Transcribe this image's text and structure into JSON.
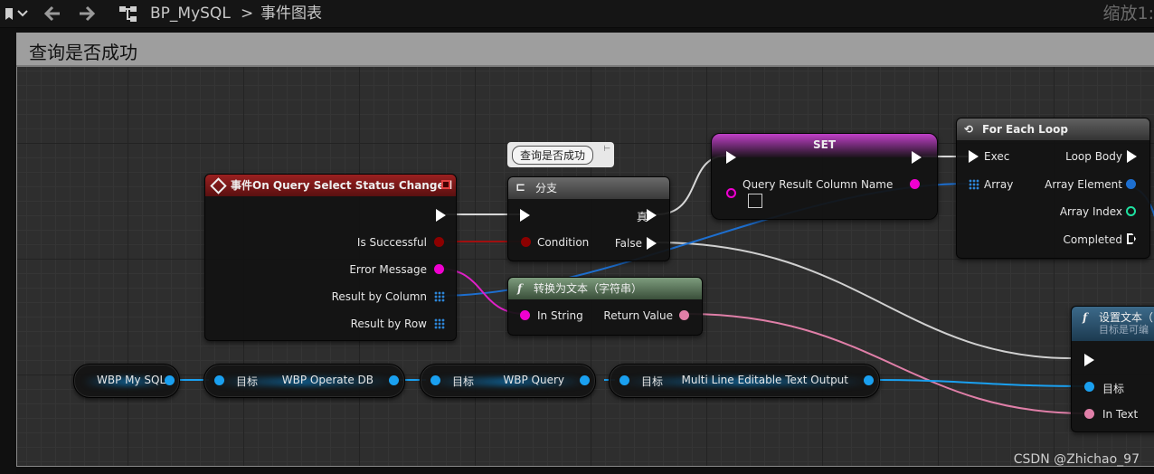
{
  "toolbar": {
    "breadcrumb_blueprint": "BP_MySQL",
    "breadcrumb_separator": ">",
    "breadcrumb_graph": "事件图表",
    "zoom": "缩放1:"
  },
  "comment": {
    "title": "查询是否成功"
  },
  "event_node": {
    "title": "事件On Query Select Status Changed",
    "pins": [
      "Is Successful",
      "Error Message",
      "Result by Column",
      "Result by Row"
    ]
  },
  "branch_node": {
    "tooltip": "查询是否成功",
    "title": "分支",
    "condition": "Condition",
    "true_label": "真",
    "false_label": "False"
  },
  "set_node": {
    "title": "SET",
    "var_label": "Query Result Column Name"
  },
  "loop_node": {
    "title": "For Each Loop",
    "exec": "Exec",
    "array": "Array",
    "loop_body": "Loop Body",
    "array_element": "Array Element",
    "array_index": "Array Index",
    "completed": "Completed"
  },
  "convert_node": {
    "title": "转换为文本（字符串）",
    "in_string": "In String",
    "return_value": "Return Value"
  },
  "settext_node": {
    "title": "设置文本（",
    "subtitle": "目标是可编",
    "target": "目标",
    "in_text": "In Text"
  },
  "var_nodes": [
    {
      "left": "",
      "right": "WBP My SQL"
    },
    {
      "left": "目标",
      "right": "WBP Operate DB"
    },
    {
      "left": "目标",
      "right": "WBP Query"
    },
    {
      "left": "目标",
      "right": "Multi Line Editable Text Output"
    }
  ],
  "watermark": "CSDN @Zhichao_97",
  "colors": {
    "exec": "#ffffff",
    "bool": "#8c0000",
    "string": "#f000d0",
    "text": "#e07fa8",
    "object": "#1aa0f0",
    "array": "#2d86d8",
    "int": "#1fe0a0",
    "event_header": "#8a1a1a",
    "function_header": "#4f6e4f",
    "set_header": "#8a2a9a"
  }
}
